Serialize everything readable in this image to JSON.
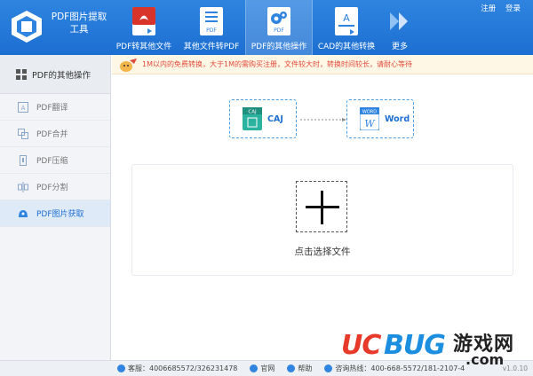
{
  "app": {
    "title_line1": "PDF图片提取",
    "title_line2": "工具"
  },
  "top_links": {
    "register": "注册",
    "login": "登录"
  },
  "toolbar": [
    {
      "label": "PDF转其他文件",
      "icon": "pdf-red-icon",
      "active": false
    },
    {
      "label": "其他文件转PDF",
      "icon": "doc-to-pdf-icon",
      "active": false
    },
    {
      "label": "PDF的其他操作",
      "icon": "pdf-gear-icon",
      "active": true
    },
    {
      "label": "CAD的其他转换",
      "icon": "cad-icon",
      "active": false
    },
    {
      "label": "更多",
      "icon": "double-chevron-icon",
      "active": false
    }
  ],
  "sidebar": {
    "header": "PDF的其他操作",
    "items": [
      {
        "label": "PDF翻译",
        "icon": "translate-icon",
        "active": false
      },
      {
        "label": "PDF合并",
        "icon": "merge-icon",
        "active": false
      },
      {
        "label": "PDF压缩",
        "icon": "compress-icon",
        "active": false
      },
      {
        "label": "PDF分割",
        "icon": "split-icon",
        "active": false
      },
      {
        "label": "PDF图片获取",
        "icon": "image-extract-icon",
        "active": true
      }
    ]
  },
  "notice": "1M以内的免费转换，大于1M的需购买注册，文件较大时，转换时间较长，请耐心等待",
  "conversion": {
    "source_badge": "CAJ",
    "source_label": "CAJ",
    "target_badge": "WORD",
    "target_label": "Word"
  },
  "upload": {
    "label": "点击选择文件"
  },
  "status_bar": {
    "service": "客服：4006685572/326231478",
    "website": "官网",
    "help": "帮助",
    "hotline": "咨询热线：400-668-5572/181-2107-4",
    "version": "v1.0.10"
  },
  "watermark": {
    "uc": "UC",
    "bug": "BUG",
    "cn": "游戏网",
    "com": ".com"
  },
  "colors": {
    "header": "#1c6fd1",
    "accent": "#4a9de0",
    "notice_text": "#e04a3a"
  }
}
